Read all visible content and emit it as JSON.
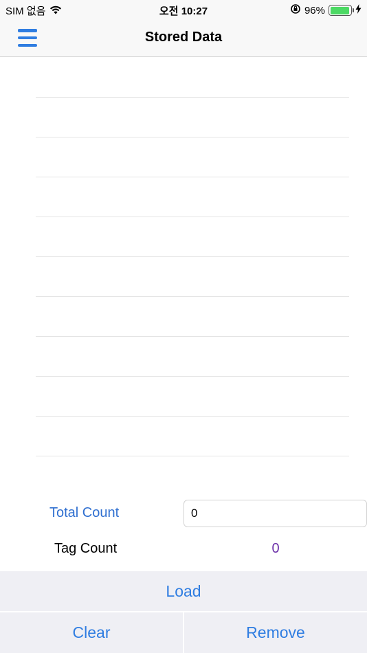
{
  "status_bar": {
    "carrier": "SIM 없음",
    "time": "오전 10:27",
    "battery_percent": "96%",
    "battery_level": 0.96
  },
  "nav": {
    "title": "Stored Data",
    "menu_icon": "hamburger-menu-icon"
  },
  "list": {
    "rows": [
      "",
      "",
      "",
      "",
      "",
      "",
      "",
      "",
      "",
      ""
    ]
  },
  "counts": {
    "total_label": "Total Count",
    "total_value": "0",
    "tag_label": "Tag Count",
    "tag_value": "0"
  },
  "buttons": {
    "load": "Load",
    "clear": "Clear",
    "remove": "Remove"
  },
  "colors": {
    "accent": "#2f7de1",
    "tag_value": "#6b2fa8",
    "button_bg": "#efeff4",
    "battery": "#4cd964"
  }
}
